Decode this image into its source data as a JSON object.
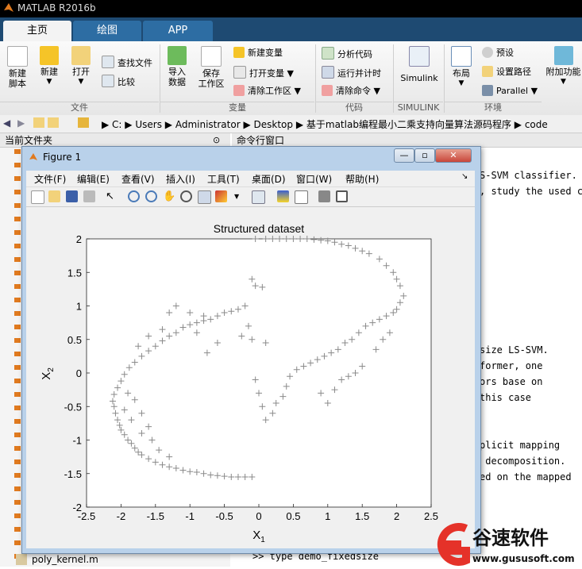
{
  "app": {
    "title": "MATLAB R2016b"
  },
  "tabs": [
    {
      "label": "主页",
      "active": true
    },
    {
      "label": "绘图",
      "active": false
    },
    {
      "label": "APP",
      "active": false
    }
  ],
  "ribbon": {
    "file": {
      "new_script": "新建\n脚本",
      "new": "新建",
      "open": "打开",
      "find_files": "查找文件",
      "compare": "比较",
      "group": "文件"
    },
    "variable": {
      "import": "导入\n数据",
      "save_ws": "保存\n工作区",
      "new_var": "新建变量",
      "open_var": "打开变量",
      "clear_ws": "清除工作区",
      "group": "变量"
    },
    "code": {
      "analyze": "分析代码",
      "run_time": "运行并计时",
      "clear_cmd": "清除命令",
      "group": "代码"
    },
    "simulink": {
      "label": "Simulink",
      "group": "SIMULINK"
    },
    "env": {
      "layout": "布局",
      "prefs": "预设",
      "set_path": "设置路径",
      "parallel": "Parallel",
      "group": "环境",
      "addons": "附加功能"
    }
  },
  "address": {
    "segments": [
      "C:",
      "Users",
      "Administrator",
      "Desktop",
      "基于matlab编程最小二乘支持向量算法源码程序",
      "code"
    ]
  },
  "left_panel": {
    "title": "当前文件夹",
    "last_file": "poly_kernel.m"
  },
  "right_panel": {
    "title": "命令行窗口",
    "lines": [
      "S-SVM classifier.",
      ", study the used co",
      "size LS-SVM.",
      "former, one",
      "ors base on",
      "this case",
      "plicit mapping",
      " decomposition.",
      "ed on the mapped",
      ">> type demo_fixedsize"
    ]
  },
  "figure": {
    "title": "Figure 1",
    "menu": [
      "文件(F)",
      "编辑(E)",
      "查看(V)",
      "插入(I)",
      "工具(T)",
      "桌面(D)",
      "窗口(W)",
      "帮助(H)"
    ],
    "buttons": {
      "minimize": "—",
      "maximize": "▫",
      "close": "✕"
    }
  },
  "chart_data": {
    "type": "scatter",
    "title": "Structured dataset",
    "xlabel": "X",
    "xlabel_sub": "1",
    "ylabel": "X",
    "ylabel_sub": "2",
    "xlim": [
      -2.5,
      2.5
    ],
    "ylim": [
      -2,
      2
    ],
    "xticks": [
      "-2.5",
      "-2",
      "-1.5",
      "-1",
      "-0.5",
      "0",
      "0.5",
      "1",
      "1.5",
      "2",
      "2.5"
    ],
    "yticks": [
      "-2",
      "-1.5",
      "-1",
      "-0.5",
      "0",
      "0.5",
      "1",
      "1.5",
      "2"
    ],
    "marker": "+",
    "color": "#8a8a8a",
    "series": [
      {
        "points": [
          [
            -0.1,
            -1.55
          ],
          [
            -0.2,
            -1.55
          ],
          [
            -0.3,
            -1.55
          ],
          [
            -0.4,
            -1.55
          ],
          [
            -0.5,
            -1.54
          ],
          [
            -0.6,
            -1.53
          ],
          [
            -0.7,
            -1.52
          ],
          [
            -0.8,
            -1.5
          ],
          [
            -0.9,
            -1.48
          ],
          [
            -1.0,
            -1.47
          ],
          [
            -1.1,
            -1.45
          ],
          [
            -1.2,
            -1.42
          ],
          [
            -1.3,
            -1.4
          ],
          [
            -1.4,
            -1.37
          ],
          [
            -1.5,
            -1.33
          ],
          [
            -1.6,
            -1.28
          ],
          [
            -1.7,
            -1.22
          ],
          [
            -1.75,
            -1.18
          ],
          [
            -1.8,
            -1.12
          ],
          [
            -1.85,
            -1.05
          ],
          [
            -1.9,
            -1.0
          ],
          [
            -1.95,
            -0.92
          ],
          [
            -2.0,
            -0.85
          ],
          [
            -2.02,
            -0.78
          ],
          [
            -2.05,
            -0.7
          ],
          [
            -2.08,
            -0.6
          ],
          [
            -2.1,
            -0.5
          ],
          [
            -2.12,
            -0.42
          ],
          [
            -2.1,
            -0.32
          ],
          [
            -2.05,
            -0.22
          ],
          [
            -2.0,
            -0.12
          ],
          [
            -1.95,
            -0.02
          ],
          [
            -1.88,
            0.08
          ],
          [
            -1.8,
            0.16
          ],
          [
            -1.7,
            0.25
          ],
          [
            -1.6,
            0.33
          ],
          [
            -1.5,
            0.4
          ],
          [
            -1.4,
            0.48
          ],
          [
            -1.3,
            0.55
          ],
          [
            -1.2,
            0.6
          ],
          [
            -1.1,
            0.68
          ],
          [
            -1.0,
            0.72
          ],
          [
            -0.9,
            0.75
          ],
          [
            -0.8,
            0.78
          ],
          [
            -0.7,
            0.8
          ],
          [
            -0.6,
            0.85
          ],
          [
            -0.5,
            0.9
          ],
          [
            -0.4,
            0.92
          ],
          [
            -0.3,
            0.95
          ],
          [
            -0.2,
            1.0
          ],
          [
            -0.15,
            0.7
          ],
          [
            -0.1,
            1.4
          ],
          [
            -0.05,
            1.3
          ],
          [
            0.05,
            1.28
          ],
          [
            -0.1,
            0.5
          ],
          [
            -0.25,
            0.55
          ],
          [
            0.1,
            0.45
          ],
          [
            -0.05,
            -0.1
          ],
          [
            0.0,
            -0.3
          ],
          [
            0.05,
            -0.5
          ],
          [
            0.1,
            -0.7
          ],
          [
            0.2,
            -0.6
          ],
          [
            0.25,
            -0.45
          ],
          [
            0.35,
            -0.35
          ],
          [
            0.4,
            -0.2
          ],
          [
            0.45,
            -0.05
          ],
          [
            0.55,
            0.05
          ],
          [
            0.65,
            0.1
          ],
          [
            0.75,
            0.15
          ],
          [
            0.85,
            0.2
          ],
          [
            0.95,
            0.25
          ],
          [
            1.05,
            0.3
          ],
          [
            1.15,
            0.35
          ],
          [
            1.25,
            0.45
          ],
          [
            1.35,
            0.5
          ],
          [
            1.45,
            0.6
          ],
          [
            1.55,
            0.7
          ],
          [
            1.65,
            0.75
          ],
          [
            1.75,
            0.8
          ],
          [
            1.85,
            0.85
          ],
          [
            1.95,
            0.9
          ],
          [
            2.0,
            0.95
          ],
          [
            2.05,
            1.05
          ],
          [
            2.1,
            1.15
          ],
          [
            2.05,
            1.3
          ],
          [
            2.0,
            1.4
          ],
          [
            1.95,
            1.5
          ],
          [
            1.85,
            1.6
          ],
          [
            1.75,
            1.7
          ],
          [
            1.6,
            1.78
          ],
          [
            1.5,
            1.82
          ],
          [
            1.4,
            1.86
          ],
          [
            1.3,
            1.9
          ],
          [
            1.2,
            1.92
          ],
          [
            1.1,
            1.95
          ],
          [
            1.0,
            1.97
          ],
          [
            0.9,
            1.98
          ],
          [
            0.8,
            1.99
          ],
          [
            0.7,
            2.0
          ],
          [
            0.6,
            2.0
          ],
          [
            0.5,
            2.0
          ],
          [
            0.4,
            2.0
          ],
          [
            0.3,
            2.0
          ],
          [
            0.2,
            2.0
          ],
          [
            0.1,
            2.0
          ],
          [
            -0.05,
            2.0
          ],
          [
            1.1,
            -0.25
          ],
          [
            1.0,
            -0.45
          ],
          [
            0.9,
            -0.3
          ],
          [
            1.2,
            -0.1
          ],
          [
            1.4,
            0.0
          ],
          [
            1.5,
            0.1
          ],
          [
            1.7,
            0.35
          ],
          [
            1.8,
            0.5
          ],
          [
            1.9,
            0.6
          ],
          [
            1.3,
            -0.05
          ],
          [
            -1.75,
            0.4
          ],
          [
            -1.6,
            0.55
          ],
          [
            -1.4,
            0.65
          ],
          [
            -1.3,
            0.9
          ],
          [
            -1.2,
            1.0
          ],
          [
            -1.0,
            0.9
          ],
          [
            -0.9,
            0.6
          ],
          [
            -0.8,
            0.85
          ],
          [
            -0.75,
            0.3
          ],
          [
            -0.6,
            0.45
          ],
          [
            -1.8,
            -0.4
          ],
          [
            -1.9,
            -0.3
          ],
          [
            -1.7,
            -0.6
          ],
          [
            -1.6,
            -0.8
          ],
          [
            -1.55,
            -1.0
          ],
          [
            -1.45,
            -1.15
          ],
          [
            -1.3,
            -1.25
          ],
          [
            -1.7,
            -0.9
          ],
          [
            -1.85,
            -0.7
          ],
          [
            -1.95,
            -0.55
          ]
        ]
      }
    ]
  },
  "watermark": {
    "brand": "谷速软件",
    "url": "www.gususoft.com"
  }
}
